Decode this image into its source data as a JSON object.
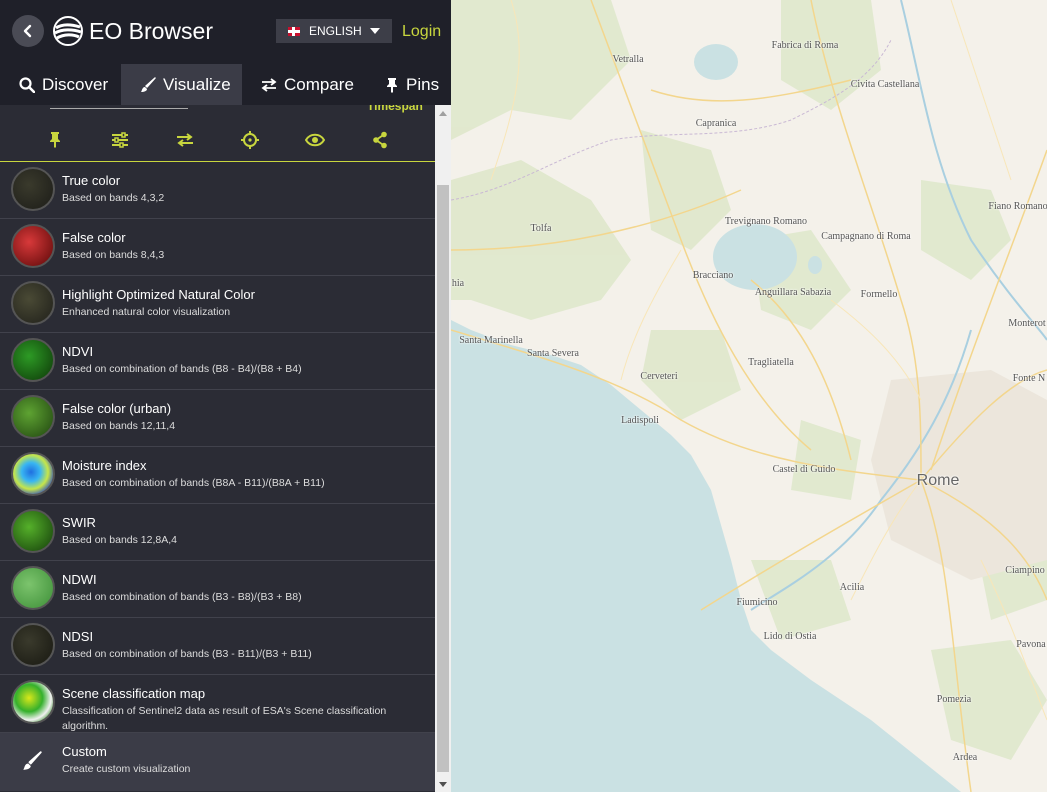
{
  "header": {
    "app_title": "EO Browser",
    "language": "ENGLISH",
    "login": "Login"
  },
  "tabs": [
    {
      "label": "Discover",
      "icon": "search-icon",
      "active": false
    },
    {
      "label": "Visualize",
      "icon": "paintbrush-icon",
      "active": true
    },
    {
      "label": "Compare",
      "icon": "compare-arrows-icon",
      "active": false
    },
    {
      "label": "Pins",
      "icon": "pin-icon",
      "active": false
    }
  ],
  "partial_row": {
    "right_text": "Timespan"
  },
  "toolbar": [
    "pin-icon",
    "sliders-icon",
    "swap-icon",
    "crosshair-icon",
    "eye-icon",
    "share-icon"
  ],
  "visualizations": [
    {
      "name": "True color",
      "desc": "Based on bands 4,3,2"
    },
    {
      "name": "False color",
      "desc": "Based on bands 8,4,3"
    },
    {
      "name": "Highlight Optimized Natural Color",
      "desc": "Enhanced natural color visualization"
    },
    {
      "name": "NDVI",
      "desc": "Based on combination of bands (B8 - B4)/(B8 + B4)"
    },
    {
      "name": "False color (urban)",
      "desc": "Based on bands 12,11,4"
    },
    {
      "name": "Moisture index",
      "desc": "Based on combination of bands (B8A - B11)/(B8A + B11)"
    },
    {
      "name": "SWIR",
      "desc": "Based on bands 12,8A,4"
    },
    {
      "name": "NDWI",
      "desc": "Based on combination of bands (B3 - B8)/(B3 + B8)"
    },
    {
      "name": "NDSI",
      "desc": "Based on combination of bands (B3 - B11)/(B3 + B11)"
    },
    {
      "name": "Scene classification map",
      "desc": "Classification of Sentinel2 data as result of ESA's Scene classification algorithm."
    },
    {
      "name": "Custom",
      "desc": "Create custom visualization"
    }
  ],
  "map_labels": {
    "fabrica": "Fabrica di Roma",
    "vetralla": "Vetralla",
    "civita": "Civita Castellana",
    "capranica": "Capranica",
    "fiano": "Fiano Romano",
    "tolfa": "Tolfa",
    "trevignano": "Trevignano Romano",
    "campagnano": "Campagnano di Roma",
    "bracciano": "Bracciano",
    "anguillara": "Anguillara Sabazia",
    "formello": "Formello",
    "hia": "hia",
    "santa_marinella": "Santa Marinella",
    "santa_severa": "Santa Severa",
    "monterotondo": "Monterot",
    "cerveteri": "Cerveteri",
    "tragliatella": "Tragliatella",
    "fonte": "Fonte N",
    "ladispoli": "Ladispoli",
    "castel_di_guido": "Castel di Guido",
    "rome": "Rome",
    "ciampino": "Ciampino",
    "acilia": "Acilia",
    "fiumicino": "Fiumicino",
    "lido": "Lido di Ostia",
    "pavona": "Pavona",
    "pomezia": "Pomezia",
    "ardea": "Ardea"
  },
  "colors": {
    "accent": "#c8d63e",
    "panel": "#2b2c35",
    "header": "#1f2029",
    "sea": "#cae1e3",
    "land": "#f4f1ea"
  }
}
